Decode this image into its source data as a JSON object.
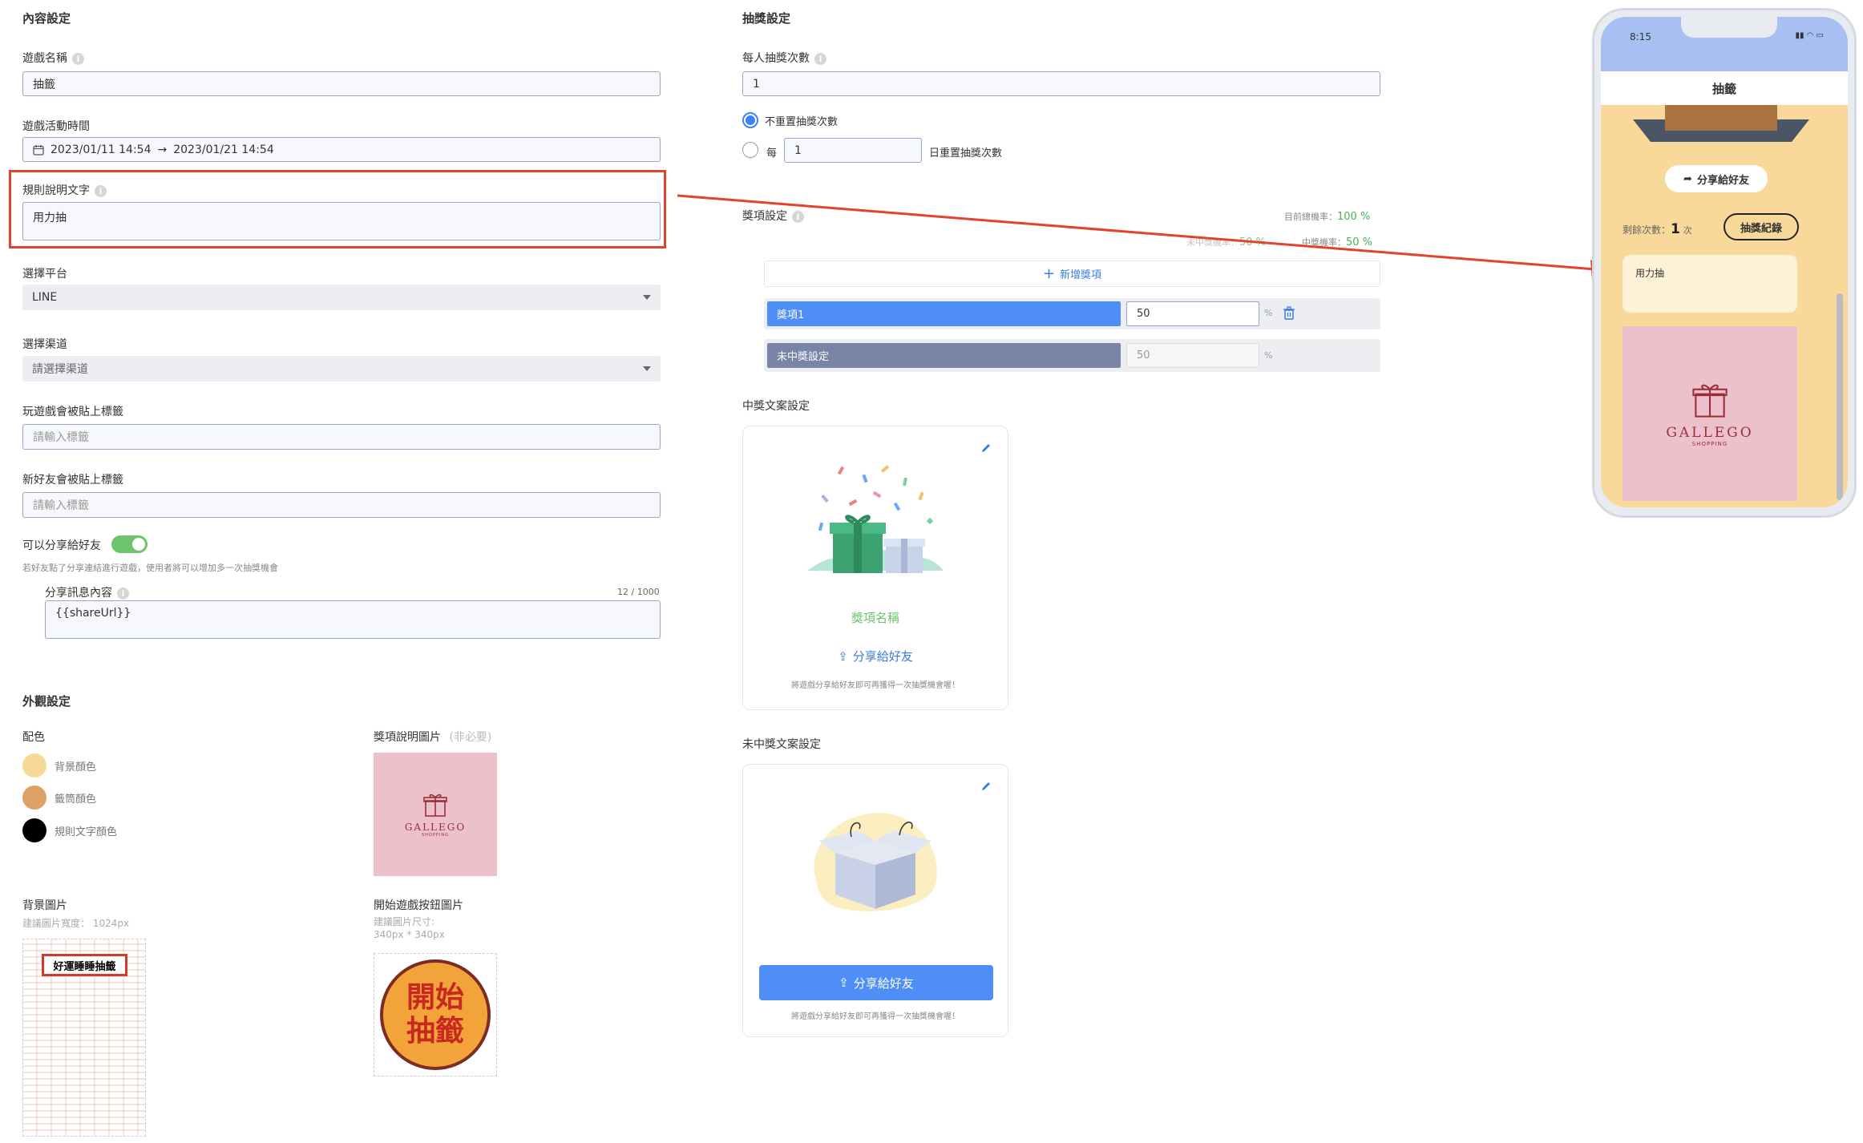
{
  "content": {
    "section_title": "內容設定",
    "game_name_label": "遊戲名稱",
    "game_name_value": "抽籤",
    "period_label": "遊戲活動時間",
    "period_start": "2023/01/11 14:54",
    "period_arrow": "→",
    "period_end": "2023/01/21 14:54",
    "rules_label": "規則說明文字",
    "rules_value": "用力抽",
    "platform_label": "選擇平台",
    "platform_value": "LINE",
    "channel_label": "選擇渠道",
    "channel_placeholder": "請選擇渠道",
    "play_tag_label": "玩遊戲會被貼上標籤",
    "play_tag_placeholder": "請輸入標籤",
    "friend_tag_label": "新好友會被貼上標籤",
    "friend_tag_placeholder": "請輸入標籤",
    "share_label": "可以分享給好友",
    "share_hint": "若好友點了分享連結進行遊戲，使用者將可以增加多一次抽獎機會",
    "share_msg_label": "分享訊息內容",
    "share_msg_count": "12 / 1000",
    "share_msg_value": "{{shareUrl}}"
  },
  "appearance": {
    "section_title": "外觀設定",
    "color_label": "配色",
    "colors": [
      {
        "name": "背景顏色",
        "hex": "#f9d99a"
      },
      {
        "name": "籤筒顏色",
        "hex": "#dfa163"
      },
      {
        "name": "規則文字顏色",
        "hex": "#000000"
      }
    ],
    "prize_img_label": "獎項說明圖片",
    "prize_img_optional": "(非必要)",
    "bg_img_label": "背景圖片",
    "bg_img_hint": "建議圖片寬度： 1024px",
    "bg_img_banner": "好運睡睡抽籤",
    "start_btn_label": "開始遊戲按鈕圖片",
    "start_btn_hint1": "建議圖片尺寸:",
    "start_btn_hint2": "340px * 340px",
    "start_btn_text1": "開始",
    "start_btn_text2": "抽籤",
    "brand_name": "GALLEGO",
    "brand_sub": "SHOPPING"
  },
  "lottery": {
    "section_title": "抽獎設定",
    "times_label": "每人抽獎次數",
    "times_value": "1",
    "no_reset_label": "不重置抽獎次數",
    "every_label": "每",
    "every_value": "1",
    "reset_days_label": "日重置抽獎次數",
    "prize_settings_label": "獎項設定",
    "total_rate_label": "目前總機率：",
    "total_rate_value": "100 %",
    "miss_rate_label": "未中獎機率：",
    "miss_rate_value": "50 %",
    "win_rate_label": "中獎機率：",
    "win_rate_value": "50 %",
    "add_prize": "新增獎項",
    "prizes": [
      {
        "name": "獎項1",
        "value": "50",
        "unit": "%"
      },
      {
        "name": "未中獎設定",
        "value": "50",
        "unit": "%"
      }
    ],
    "win_copy_label": "中獎文案設定",
    "prize_name_text": "獎項名稱",
    "share_friend": "分享給好友",
    "share_note": "將遊戲分享給好友即可再獲得一次抽獎機會喔！",
    "lose_copy_label": "未中獎文案設定"
  },
  "phone": {
    "time": "8:15",
    "title": "抽籤",
    "share_btn": "分享給好友",
    "remaining_label": "剩餘次數：",
    "remaining_count": "1",
    "remaining_unit": "次",
    "record_btn": "抽獎紀錄",
    "rules_text": "用力抽"
  }
}
